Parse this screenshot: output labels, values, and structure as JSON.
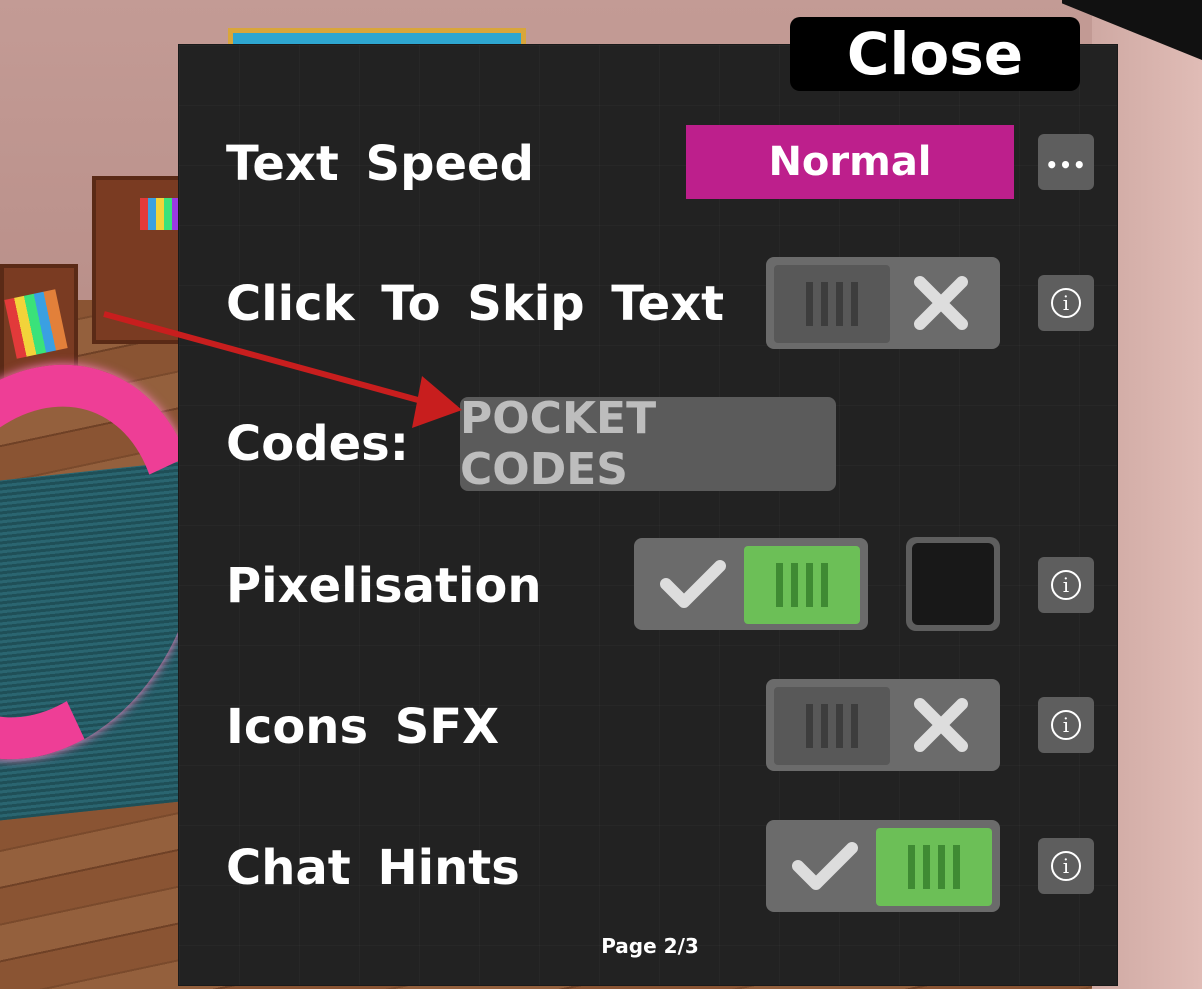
{
  "dialog": {
    "close_label": "Close",
    "page_indicator": "Page 2/3"
  },
  "settings": {
    "text_speed": {
      "label": "Text Speed",
      "value": "Normal",
      "more_icon": "ellipsis-icon"
    },
    "click_to_skip": {
      "label": "Click To Skip Text",
      "enabled": false,
      "info_icon": "info-icon"
    },
    "codes": {
      "label": "Codes:",
      "button_label": "POCKET CODES"
    },
    "pixelisation": {
      "label": "Pixelisation",
      "enabled": true,
      "swatch_color": "#181818",
      "info_icon": "info-icon"
    },
    "icons_sfx": {
      "label": "Icons SFX",
      "enabled": false,
      "info_icon": "info-icon"
    },
    "chat_hints": {
      "label": "Chat Hints",
      "enabled": true,
      "info_icon": "info-icon"
    }
  },
  "colors": {
    "accent": "#bd1f8c",
    "toggle_on": "#6cbf57",
    "toggle_off": "#585858",
    "panel_bg": "#222222",
    "arrow": "#c81e1e"
  }
}
